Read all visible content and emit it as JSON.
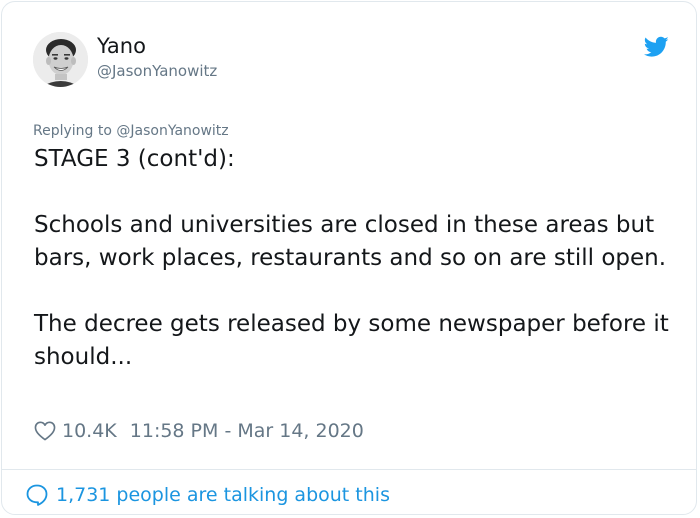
{
  "author": {
    "name": "Yano",
    "handle": "@JasonYanowitz"
  },
  "reply": {
    "text": "Replying to @JasonYanowitz"
  },
  "tweet": {
    "text": "STAGE 3 (cont'd):\n\nSchools and universities are closed in these areas but bars, work places, restaurants and so on are still open.\n\nThe decree gets released by some newspaper before it should..."
  },
  "meta": {
    "likes": "10.4K",
    "timestamp": "11:58 PM - Mar 14, 2020"
  },
  "footer": {
    "talking": "1,731 people are talking about this"
  },
  "colors": {
    "brand": "#1da1f2",
    "link": "#1b95e0",
    "secondary": "#657786",
    "border": "#e1e8ed"
  },
  "icons": {
    "logo": "twitter-bird-icon",
    "like": "heart-outline-icon",
    "conversation": "speech-bubble-icon"
  }
}
